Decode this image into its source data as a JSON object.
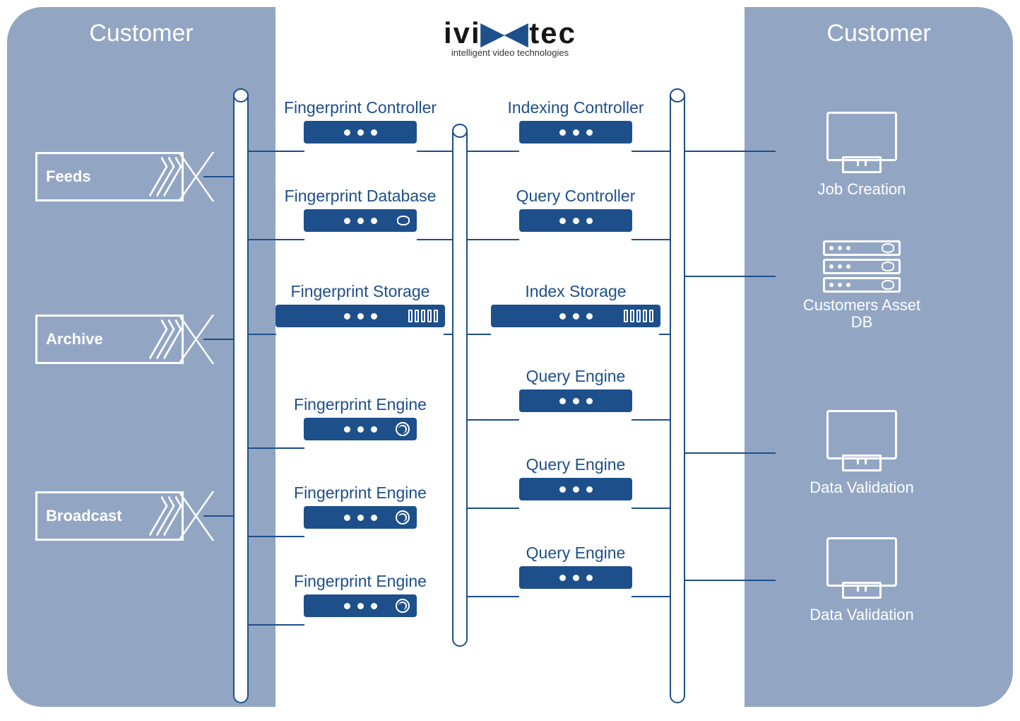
{
  "logo": {
    "text": "ivitec",
    "subtitle": "intelligent video technologies"
  },
  "left_panel": {
    "title": "Customer",
    "tags": [
      {
        "label": "Feeds"
      },
      {
        "label": "Archive"
      },
      {
        "label": "Broadcast"
      }
    ]
  },
  "right_panel": {
    "title": "Customer",
    "items": [
      {
        "label": "Job Creation",
        "icon": "monitor"
      },
      {
        "label": "Customers Asset DB",
        "icon": "rack"
      },
      {
        "label": "Data Validation",
        "icon": "monitor"
      },
      {
        "label": "Data Validation",
        "icon": "monitor"
      }
    ]
  },
  "center_left": [
    {
      "label": "Fingerprint Controller",
      "decor": "dots"
    },
    {
      "label": "Fingerprint Database",
      "decor": "db"
    },
    {
      "label": "Fingerprint Storage",
      "decor": "slots",
      "wide": true
    },
    {
      "label": "Fingerprint Engine",
      "decor": "fp"
    },
    {
      "label": "Fingerprint Engine",
      "decor": "fp"
    },
    {
      "label": "Fingerprint Engine",
      "decor": "fp"
    }
  ],
  "center_right": [
    {
      "label": "Indexing Controller",
      "decor": "dots"
    },
    {
      "label": "Query Controller",
      "decor": "dots"
    },
    {
      "label": "Index Storage",
      "decor": "slots",
      "wide": true
    },
    {
      "label": "Query Engine",
      "decor": "dots"
    },
    {
      "label": "Query Engine",
      "decor": "dots"
    },
    {
      "label": "Query Engine",
      "decor": "dots"
    }
  ]
}
